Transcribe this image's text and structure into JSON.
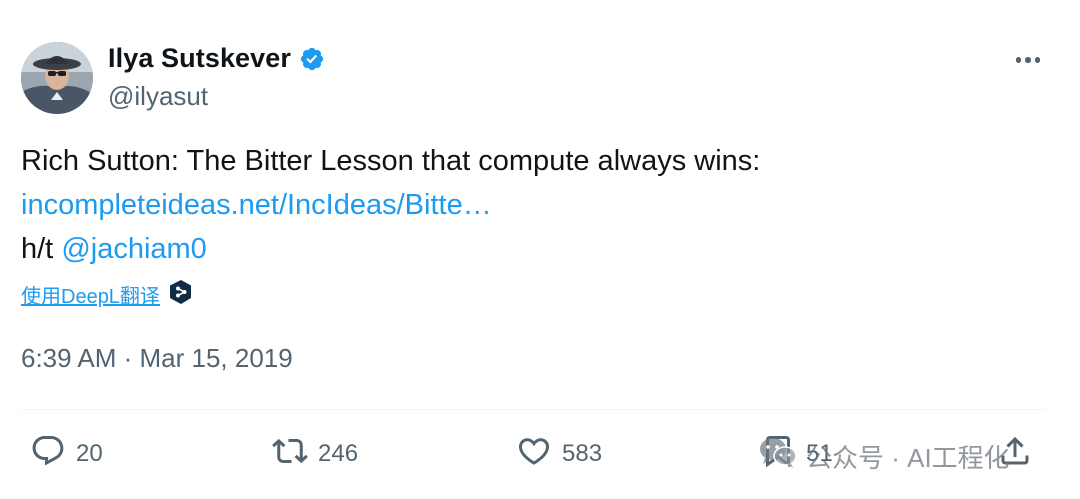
{
  "author": {
    "display_name": "Ilya Sutskever",
    "handle": "@ilyasut",
    "verified": true
  },
  "tweet": {
    "text_line1": "Rich Sutton:  The Bitter Lesson that compute always wins:",
    "link_text": "incompleteideas.net/IncIdeas/Bitte…",
    "ht_prefix": "h/t ",
    "mention": "@jachiam0",
    "translate_label": "使用DeepL翻译",
    "timestamp": "6:39 AM · Mar 15, 2019"
  },
  "actions": {
    "replies": "20",
    "retweets": "246",
    "likes": "583",
    "bookmarks": "51"
  },
  "watermark": {
    "text": "公众号 · AI工程化"
  },
  "icons": {
    "verified": "verified-badge-icon",
    "more": "more-icon",
    "reply": "reply-icon",
    "retweet": "retweet-icon",
    "like": "heart-icon",
    "bookmark": "bookmark-icon",
    "share": "share-icon",
    "deepl": "deepl-icon",
    "watermark": "wechat-icon"
  },
  "colors": {
    "accent": "#1d9bf0",
    "text": "#0f1419",
    "muted": "#536471",
    "divider": "#eff3f4",
    "deepl": "#0f2b46"
  }
}
